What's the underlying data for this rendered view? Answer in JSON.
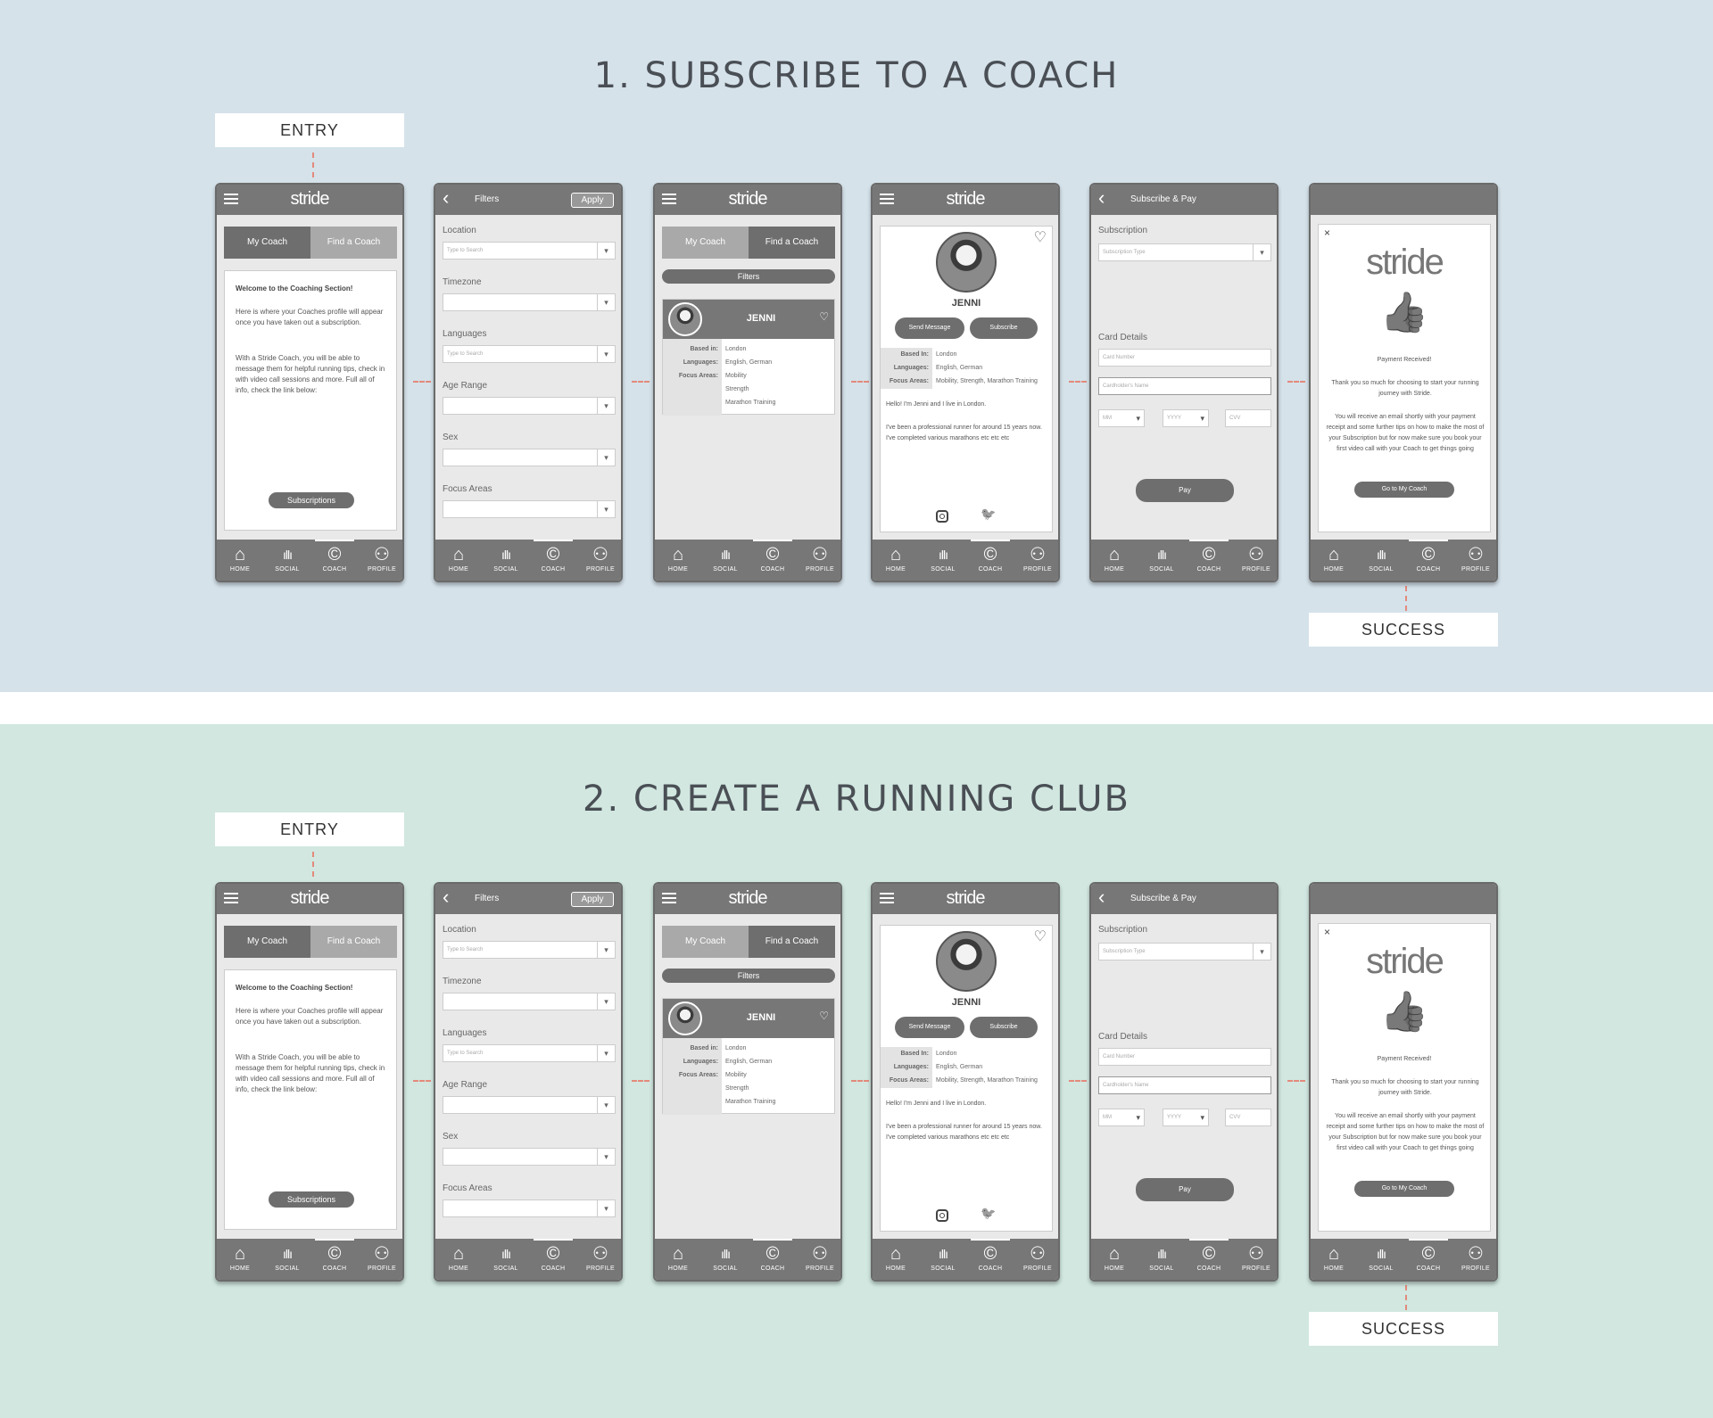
{
  "flows": [
    {
      "title": "1. SUBSCRIBE TO A COACH",
      "entry_label": "ENTRY",
      "success_label": "SUCCESS",
      "band_color": "#d5e2ea"
    },
    {
      "title": "2. CREATE A RUNNING CLUB",
      "entry_label": "ENTRY",
      "success_label": "SUCCESS",
      "band_color": "#d1e7e0"
    }
  ],
  "app": {
    "logo": "stride",
    "nav": [
      {
        "label": "HOME",
        "icon": "home-icon",
        "glyph": "⌂"
      },
      {
        "label": "SOCIAL",
        "icon": "soundwave-icon",
        "glyph": "ıllı"
      },
      {
        "label": "COACH",
        "icon": "copyright-coach-icon",
        "glyph": "©"
      },
      {
        "label": "PROFILE",
        "icon": "user-icon",
        "glyph": "⚇"
      }
    ]
  },
  "screens": {
    "my_coach": {
      "tab_my_coach": "My Coach",
      "tab_find_coach": "Find a Coach",
      "welcome_title": "Welcome to the Coaching Section!",
      "welcome_p1": "Here is where your Coaches profile will appear once you have taken out a subscription.",
      "welcome_p2": "With a Stride Coach, you will be able to message them for helpful running tips, check in with video call sessions and more. Full all of info, check the link below:",
      "subscriptions_button": "Subscriptions"
    },
    "filters": {
      "title": "Filters",
      "apply": "Apply",
      "fields": [
        {
          "label": "Location",
          "placeholder": "Type to Search"
        },
        {
          "label": "Timezone",
          "placeholder": ""
        },
        {
          "label": "Languages",
          "placeholder": "Type to Search"
        },
        {
          "label": "Age Range",
          "placeholder": ""
        },
        {
          "label": "Sex",
          "placeholder": ""
        },
        {
          "label": "Focus Areas",
          "placeholder": ""
        }
      ]
    },
    "find_coach": {
      "filters_button": "Filters",
      "coach_name": "JENNI",
      "based_in_label": "Based in:",
      "languages_label": "Languages:",
      "focus_label": "Focus Areas:",
      "based_in": "London",
      "languages": "English, German",
      "focus_areas": [
        "Mobility",
        "Strength",
        "Marathon Training"
      ]
    },
    "coach_profile": {
      "name": "JENNI",
      "send_message": "Send Message",
      "subscribe": "Subscribe",
      "based_in_label": "Based In:",
      "languages_label": "Languages:",
      "focus_label": "Focus Areas:",
      "based_in": "London",
      "languages": "English, German",
      "focus_areas": "Mobility, Strength, Marathon Training",
      "bio1": "Hello! I'm Jenni and I live in London.",
      "bio2": "I've been a professional runner for around 15 years now. I've completed various marathons etc etc etc"
    },
    "subscribe_pay": {
      "title": "Subscribe & Pay",
      "subscription_label": "Subscription",
      "subscription_placeholder": "Subscription Type",
      "card_details_label": "Card Details",
      "card_number_placeholder": "Card Number",
      "cardholder_placeholder": "Cardholder's Name",
      "mm_placeholder": "MM",
      "yyyy_placeholder": "YYYY",
      "cvv_placeholder": "CVV",
      "pay_button": "Pay"
    },
    "success": {
      "close": "×",
      "logo": "stride",
      "payment_received": "Payment Received!",
      "p1": "Thank you so much for choosing to start your running journey with Stride.",
      "p2": "You will receive an email shortly with your payment receipt and some further tips on how to make the most of your Subscription but for now make sure you book your first video call with your Coach to get things going",
      "go_button": "Go to My Coach"
    }
  }
}
